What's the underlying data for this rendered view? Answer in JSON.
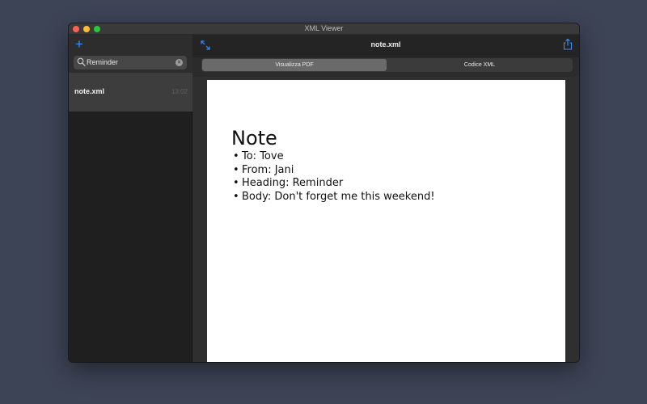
{
  "window": {
    "title": "XML Viewer"
  },
  "sidebar": {
    "add_label": "+",
    "search": {
      "value": "Reminder"
    },
    "items": [
      {
        "name": "note.xml",
        "time": "13:02"
      }
    ]
  },
  "toolbar": {
    "document_title": "note.xml"
  },
  "segments": [
    {
      "label": "Visualizza PDF",
      "selected": true
    },
    {
      "label": "Codice XML",
      "selected": false
    }
  ],
  "document": {
    "heading": "Note",
    "bullet": "•",
    "items": [
      "To: Tove",
      "From: Jani",
      "Heading: Reminder",
      "Body: Don't forget me this weekend!"
    ]
  },
  "colors": {
    "accent": "#3b8ef7",
    "desktop": "#3d4456"
  },
  "icons": {
    "add": "plus-icon",
    "search": "search-icon",
    "clear": "clear-icon",
    "expand": "expand-icon",
    "share": "share-icon"
  }
}
